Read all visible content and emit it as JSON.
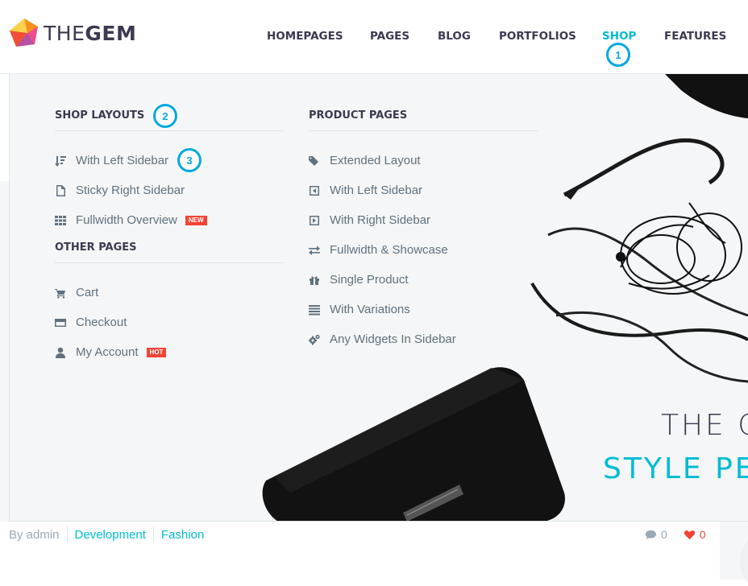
{
  "header": {
    "logo_text_light": "THE",
    "logo_text_bold": "GEM",
    "nav": [
      {
        "label": "HOMEPAGES"
      },
      {
        "label": "PAGES"
      },
      {
        "label": "BLOG"
      },
      {
        "label": "PORTFOLIOS"
      },
      {
        "label": "SHOP",
        "active": true
      },
      {
        "label": "FEATURES"
      }
    ]
  },
  "annotations": [
    "1",
    "2",
    "3"
  ],
  "mega_menu": {
    "shop_layouts": {
      "title": "SHOP LAYOUTS",
      "items": [
        {
          "label": "With Left Sidebar",
          "icon": "sort-icon"
        },
        {
          "label": "Sticky Right Sidebar",
          "icon": "file-icon"
        },
        {
          "label": "Fullwidth Overview",
          "icon": "grid-icon",
          "tag": "NEW"
        }
      ]
    },
    "other_pages": {
      "title": "OTHER PAGES",
      "items": [
        {
          "label": "Cart",
          "icon": "cart-icon"
        },
        {
          "label": "Checkout",
          "icon": "credit-card-icon"
        },
        {
          "label": "My Account",
          "icon": "user-icon",
          "tag": "HOT"
        }
      ]
    },
    "product_pages": {
      "title": "PRODUCT PAGES",
      "items": [
        {
          "label": "Extended Layout",
          "icon": "tags-icon"
        },
        {
          "label": "With Left Sidebar",
          "icon": "caret-square-left-icon"
        },
        {
          "label": "With Right Sidebar",
          "icon": "caret-square-right-icon"
        },
        {
          "label": "Fullwidth & Showcase",
          "icon": "exchange-icon"
        },
        {
          "label": "Single Product",
          "icon": "gift-icon"
        },
        {
          "label": "With Variations",
          "icon": "list-icon"
        },
        {
          "label": "Any Widgets In Sidebar",
          "icon": "cogs-icon"
        }
      ]
    }
  },
  "hero": {
    "line1": "THE C",
    "line2": "STYLE PE"
  },
  "post_meta": {
    "author": "By admin",
    "categories": [
      "Development",
      "Fashion"
    ],
    "comments": "0",
    "likes": "0"
  },
  "colors": {
    "accent": "#00bcd4",
    "text_dark": "#3c3950",
    "text_muted": "#5f727f",
    "tag_red": "#f44336",
    "annotation_blue": "#00a8e0"
  }
}
